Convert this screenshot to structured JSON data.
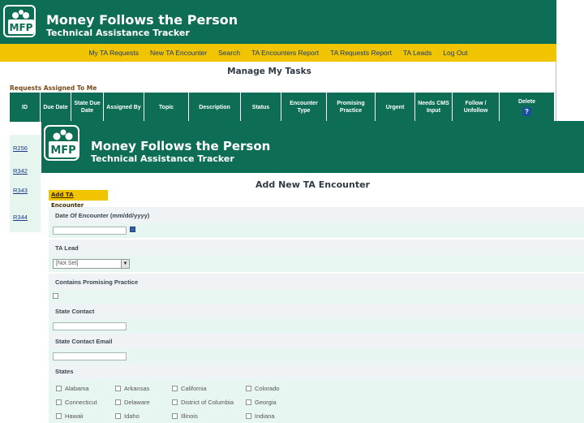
{
  "back": {
    "app_title": "Money Follows the Person",
    "app_subtitle": "Technical Assistance Tracker",
    "nav": [
      "My TA Requests",
      "New TA Encounter",
      "Search",
      "TA Encounters Report",
      "TA Requests Report",
      "TA Leads",
      "Log Out"
    ],
    "page_title": "Manage My Tasks",
    "section_label": "Requests Assigned To Me",
    "columns": [
      "ID",
      "Due Date",
      "State Due Date",
      "Assigned By",
      "Topic",
      "Description",
      "Status",
      "Encounter Type",
      "Promising Practice",
      "Urgent",
      "Needs CMS Input",
      "Follow / Unfollow",
      "Delete"
    ],
    "ids": [
      "R256",
      "R342",
      "R343",
      "R344"
    ],
    "help_icon": "?"
  },
  "front": {
    "app_title": "Money Follows the Person",
    "app_subtitle": "Technical Assistance Tracker",
    "page_title": "Add New TA Encounter",
    "add_button": "Add TA Encounter",
    "fields": {
      "date_label": "Date Of Encounter (mm/dd/yyyy)",
      "date_value": "",
      "ta_lead_label": "TA Lead",
      "ta_lead_value": "[Not Set]",
      "promising_label": "Contains Promising Practice",
      "state_contact_label": "State Contact",
      "state_contact_value": "",
      "state_email_label": "State Contact Email",
      "state_email_value": "",
      "states_label": "States"
    },
    "states": [
      "Alabama",
      "Arkansas",
      "California",
      "Colorado",
      "Connecticut",
      "Delaware",
      "District of Columbia",
      "Georgia",
      "Hawaii",
      "Idaho",
      "Illinois",
      "Indiana"
    ]
  },
  "colors": {
    "header_green": "#0e6e55",
    "nav_yellow": "#f1c400",
    "input_row": "#e8f6f1",
    "label_row": "#f0f3f5"
  },
  "logo_text": "MFP"
}
